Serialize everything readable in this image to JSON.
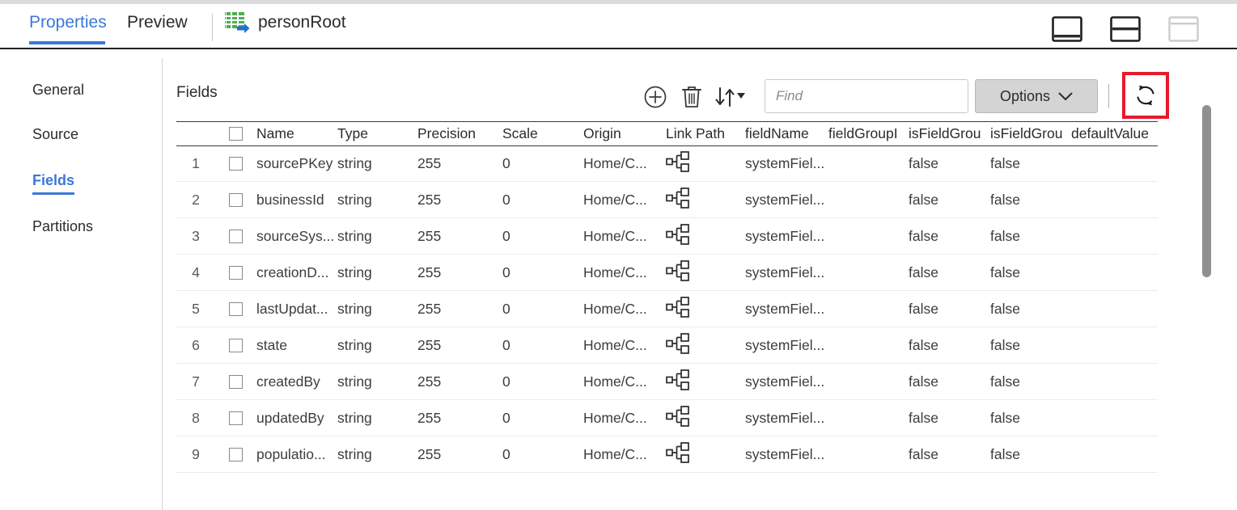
{
  "tabs": [
    {
      "label": "Properties",
      "active": true
    },
    {
      "label": "Preview",
      "active": false
    }
  ],
  "object": {
    "name": "personRoot",
    "icon": "source-table-icon"
  },
  "layout_icons": [
    {
      "name": "layout-bottom-panel-icon",
      "state": "enabled"
    },
    {
      "name": "layout-split-horizontal-icon",
      "state": "enabled"
    },
    {
      "name": "layout-single-panel-icon",
      "state": "disabled"
    }
  ],
  "sidebar": {
    "items": [
      {
        "label": "General",
        "active": false
      },
      {
        "label": "Source",
        "active": false
      },
      {
        "label": "Fields",
        "active": true
      },
      {
        "label": "Partitions",
        "active": false
      }
    ]
  },
  "panel": {
    "title": "Fields"
  },
  "toolbar": {
    "add_label": "add-field",
    "delete_label": "delete-field",
    "sort_label": "sort-fields",
    "options_label": "Options",
    "refresh_label": "refresh",
    "highlighted": "refresh-button"
  },
  "search": {
    "value": "",
    "placeholder": "Find"
  },
  "table": {
    "columns": [
      "Name",
      "Type",
      "Precision",
      "Scale",
      "Origin",
      "Link Path",
      "fieldName",
      "fieldGroupI",
      "isFieldGrou",
      "isFieldGrou",
      "defaultValue"
    ],
    "rows": [
      {
        "num": "1",
        "name": "sourcePKey",
        "type": "string",
        "precision": "255",
        "scale": "0",
        "origin": "Home/C...",
        "link_path": "link-path-icon",
        "field_name": "systemFiel...",
        "field_group": "",
        "is_field_group_1": "false",
        "is_field_group_2": "false",
        "default_value": ""
      },
      {
        "num": "2",
        "name": "businessId",
        "type": "string",
        "precision": "255",
        "scale": "0",
        "origin": "Home/C...",
        "link_path": "link-path-icon",
        "field_name": "systemFiel...",
        "field_group": "",
        "is_field_group_1": "false",
        "is_field_group_2": "false",
        "default_value": ""
      },
      {
        "num": "3",
        "name": "sourceSys...",
        "type": "string",
        "precision": "255",
        "scale": "0",
        "origin": "Home/C...",
        "link_path": "link-path-icon",
        "field_name": "systemFiel...",
        "field_group": "",
        "is_field_group_1": "false",
        "is_field_group_2": "false",
        "default_value": ""
      },
      {
        "num": "4",
        "name": "creationD...",
        "type": "string",
        "precision": "255",
        "scale": "0",
        "origin": "Home/C...",
        "link_path": "link-path-icon",
        "field_name": "systemFiel...",
        "field_group": "",
        "is_field_group_1": "false",
        "is_field_group_2": "false",
        "default_value": ""
      },
      {
        "num": "5",
        "name": "lastUpdat...",
        "type": "string",
        "precision": "255",
        "scale": "0",
        "origin": "Home/C...",
        "link_path": "link-path-icon",
        "field_name": "systemFiel...",
        "field_group": "",
        "is_field_group_1": "false",
        "is_field_group_2": "false",
        "default_value": ""
      },
      {
        "num": "6",
        "name": "state",
        "type": "string",
        "precision": "255",
        "scale": "0",
        "origin": "Home/C...",
        "link_path": "link-path-icon",
        "field_name": "systemFiel...",
        "field_group": "",
        "is_field_group_1": "false",
        "is_field_group_2": "false",
        "default_value": ""
      },
      {
        "num": "7",
        "name": "createdBy",
        "type": "string",
        "precision": "255",
        "scale": "0",
        "origin": "Home/C...",
        "link_path": "link-path-icon",
        "field_name": "systemFiel...",
        "field_group": "",
        "is_field_group_1": "false",
        "is_field_group_2": "false",
        "default_value": ""
      },
      {
        "num": "8",
        "name": "updatedBy",
        "type": "string",
        "precision": "255",
        "scale": "0",
        "origin": "Home/C...",
        "link_path": "link-path-icon",
        "field_name": "systemFiel...",
        "field_group": "",
        "is_field_group_1": "false",
        "is_field_group_2": "false",
        "default_value": ""
      },
      {
        "num": "9",
        "name": "populatio...",
        "type": "string",
        "precision": "255",
        "scale": "0",
        "origin": "Home/C...",
        "link_path": "link-path-icon",
        "field_name": "systemFiel...",
        "field_group": "",
        "is_field_group_1": "false",
        "is_field_group_2": "false",
        "default_value": ""
      }
    ]
  },
  "colors": {
    "accent": "#3b78d8",
    "highlight": "#e8192c",
    "icon_green": "#4caf50",
    "icon_blue": "#1f6fd0"
  }
}
